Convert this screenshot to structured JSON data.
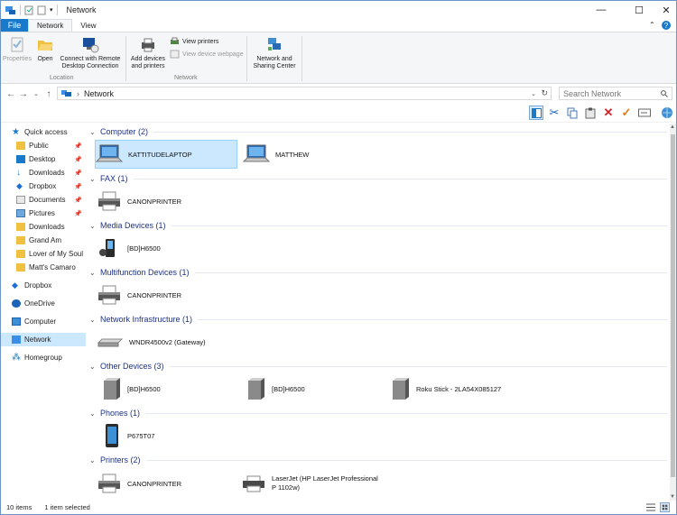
{
  "window": {
    "title": "Network",
    "minimize": "—",
    "maximize": "☐",
    "close": "✕"
  },
  "ribbon_tabs": [
    "File",
    "Network",
    "View"
  ],
  "ribbon": {
    "properties": "Properties",
    "open": "Open",
    "remote_desktop": "Connect with Remote Desktop Connection",
    "location_label": "Location",
    "add_devices": "Add devices and printers",
    "view_printers": "View printers",
    "view_device_webpage": "View device webpage",
    "network_group_label": "Network",
    "network_sharing": "Network and Sharing Center"
  },
  "address": {
    "path": "Network",
    "search_placeholder": "Search Network"
  },
  "nav": {
    "quick_access": "Quick access",
    "items": [
      "Public",
      "Desktop",
      "Downloads",
      "Dropbox",
      "Documents",
      "Pictures",
      "Downloads",
      "Grand Am",
      "Lover of My Soul",
      "Matt's Camaro"
    ],
    "dropbox": "Dropbox",
    "onedrive": "OneDrive",
    "computer": "Computer",
    "network": "Network",
    "homegroup": "Homegroup"
  },
  "groups": {
    "computer": {
      "title": "Computer (2)",
      "items": [
        "KATTITUDELAPTOP",
        "MATTHEW"
      ]
    },
    "fax": {
      "title": "FAX (1)",
      "items": [
        "CANONPRINTER"
      ]
    },
    "media": {
      "title": "Media Devices (1)",
      "items": [
        "[BD]H6500"
      ]
    },
    "multifunction": {
      "title": "Multifunction Devices (1)",
      "items": [
        "CANONPRINTER"
      ]
    },
    "infra": {
      "title": "Network Infrastructure (1)",
      "items": [
        "WNDR4500v2 (Gateway)"
      ]
    },
    "other": {
      "title": "Other Devices (3)",
      "items": [
        "[BD]H6500",
        "[BD]H6500",
        "Roku Stick - 2LA54X085127"
      ]
    },
    "phones": {
      "title": "Phones (1)",
      "items": [
        "P675T07"
      ]
    },
    "printers": {
      "title": "Printers (2)",
      "items": [
        "CANONPRINTER",
        "LaserJet (HP LaserJet Professional P 1102w)"
      ]
    }
  },
  "status": {
    "count": "10 items",
    "selected": "1 item selected"
  },
  "colors": {
    "accent": "#1979ca",
    "selection": "#cce8ff",
    "group_header": "#1e3287"
  }
}
